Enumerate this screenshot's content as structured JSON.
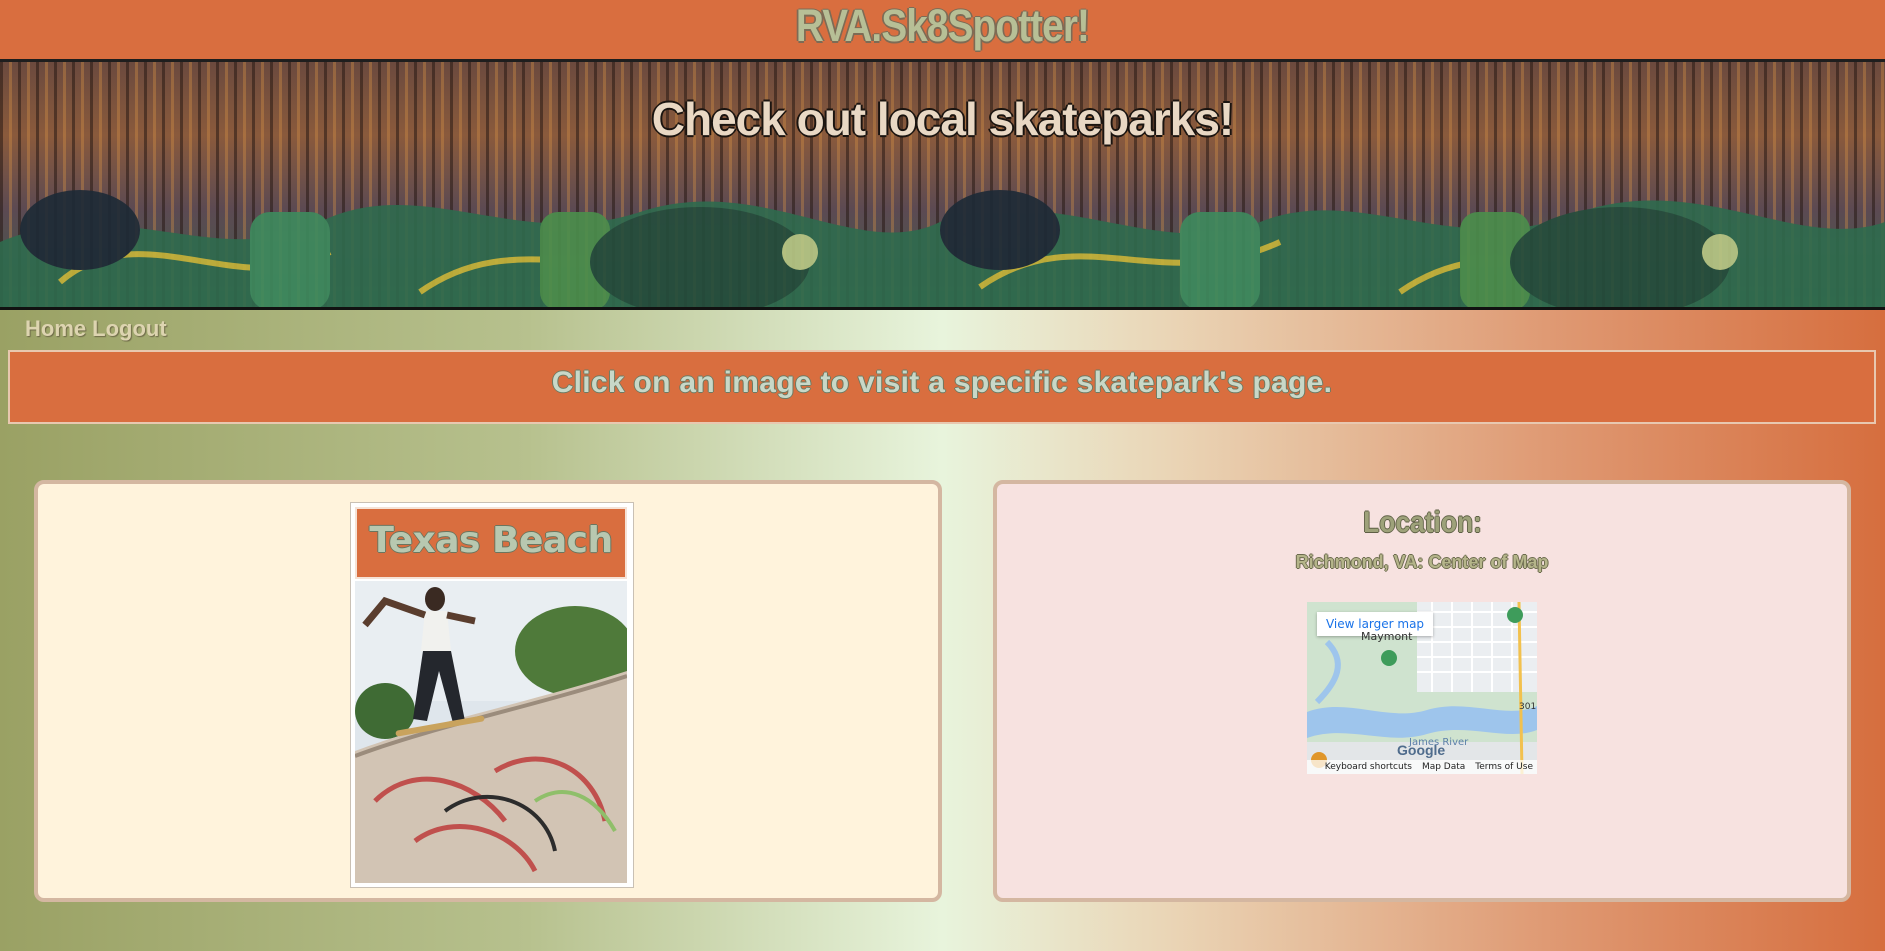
{
  "site": {
    "title": "RVA.Sk8Spotter!"
  },
  "banner": {
    "headline": "Check out local skateparks!"
  },
  "nav": {
    "items": [
      {
        "label": "Home"
      },
      {
        "label": "Logout"
      }
    ]
  },
  "instruction": {
    "text": "Click on an image to visit a specific skatepark's page."
  },
  "park": {
    "name": "Texas Beach"
  },
  "location": {
    "heading": "Location:",
    "subheading": "Richmond, VA: Center of Map"
  },
  "map": {
    "view_larger_label": "View larger map",
    "place_label": "Maymont",
    "river_label": "James River",
    "highway_label": "301",
    "logo_text": "Google",
    "footer": {
      "shortcuts": "Keyboard shortcuts",
      "data": "Map Data",
      "terms": "Terms of Use"
    }
  },
  "colors": {
    "header_orange": "#d96e3f",
    "card_left_bg": "#fff3dc",
    "card_right_bg": "#f7e2e0"
  }
}
